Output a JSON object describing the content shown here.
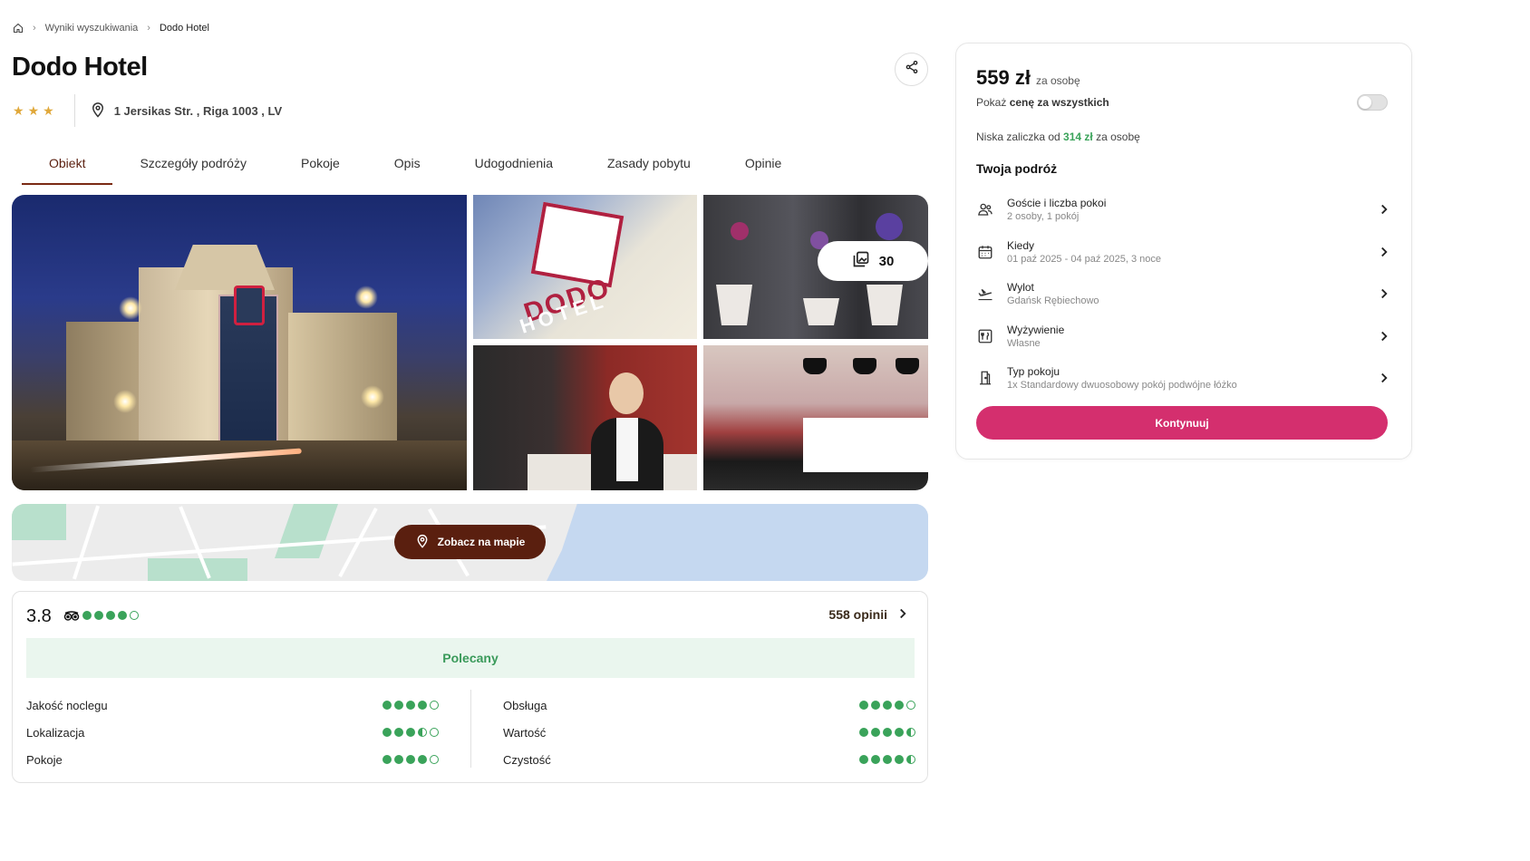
{
  "breadcrumb": {
    "items": [
      "Wyniki wyszukiwania",
      "Dodo Hotel"
    ]
  },
  "hotel": {
    "name": "Dodo Hotel",
    "stars": 3,
    "address": "1 Jersikas Str. , Riga 1003 , LV"
  },
  "tabs": [
    {
      "label": "Obiekt",
      "active": true
    },
    {
      "label": "Szczegóły podróży",
      "active": false
    },
    {
      "label": "Pokoje",
      "active": false
    },
    {
      "label": "Opis",
      "active": false
    },
    {
      "label": "Udogodnienia",
      "active": false
    },
    {
      "label": "Zasady pobytu",
      "active": false
    },
    {
      "label": "Opinie",
      "active": false
    }
  ],
  "gallery": {
    "photo_count": "30",
    "sign_text": "DODO",
    "sign_text2": "HOTEL"
  },
  "map": {
    "button_label": "Zobacz na mapie"
  },
  "reviews": {
    "score": "3.8",
    "score_bubbles": 4,
    "count_label": "558 opinii",
    "badge": "Polecany",
    "left": [
      {
        "label": "Jakość noclegu",
        "rating": 4
      },
      {
        "label": "Lokalizacja",
        "rating": 3.5
      },
      {
        "label": "Pokoje",
        "rating": 4
      }
    ],
    "right": [
      {
        "label": "Obsługa",
        "rating": 4
      },
      {
        "label": "Wartość",
        "rating": 4.5
      },
      {
        "label": "Czystość",
        "rating": 4.5
      }
    ]
  },
  "booking": {
    "price": "559 zł",
    "per_person": "za osobę",
    "toggle_prefix": "Pokaż",
    "toggle_bold": "cenę za wszystkich",
    "toggle_on": false,
    "deposit_prefix": "Niska zaliczka od",
    "deposit_amount": "314 zł",
    "deposit_suffix": "za osobę",
    "trip_title": "Twoja podróż",
    "items": [
      {
        "icon": "guests-icon",
        "label": "Goście i liczba pokoi",
        "value": "2 osoby, 1 pokój"
      },
      {
        "icon": "calendar-icon",
        "label": "Kiedy",
        "value": "01 paź 2025 - 04 paź 2025, 3 noce"
      },
      {
        "icon": "plane-departure-icon",
        "label": "Wylot",
        "value": "Gdańsk Rębiechowo"
      },
      {
        "icon": "meal-icon",
        "label": "Wyżywienie",
        "value": "Własne"
      },
      {
        "icon": "room-door-icon",
        "label": "Typ pokoju",
        "value": "1x Standardowy dwuosobowy pokój podwójne łóżko"
      }
    ],
    "continue_label": "Kontynuuj"
  },
  "colors": {
    "accent_brown": "#5a1f0f",
    "cta_pink": "#d42f6e",
    "rating_green": "#3aa35a",
    "star_gold": "#e0a83a"
  }
}
